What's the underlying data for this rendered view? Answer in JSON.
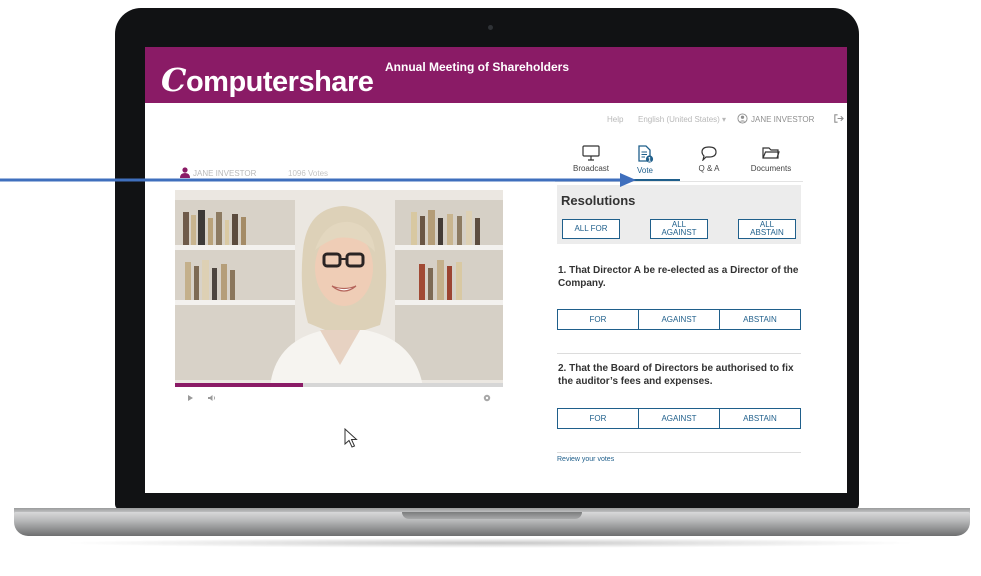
{
  "app": {
    "brand": "Computershare",
    "meeting_title": "Annual Meeting of Shareholders",
    "brand_color": "#8a1b66",
    "accent_color": "#1f5f8b"
  },
  "utility_bar": {
    "help": "Help",
    "language": "English (United States) ▾",
    "user_name": "JANE INVESTOR",
    "user_icon": "user-circle-icon",
    "logout_icon": "logout-icon"
  },
  "presenter": {
    "name": "JANE INVESTOR",
    "votes": "1096 Votes"
  },
  "video": {
    "progress": 0.39
  },
  "tabs": [
    {
      "label": "Broadcast",
      "icon": "monitor-icon"
    },
    {
      "label": "Vote",
      "icon": "document-icon",
      "badge": "1",
      "active": true
    },
    {
      "label": "Q & A",
      "icon": "speech-bubble-icon"
    },
    {
      "label": "Documents",
      "icon": "folder-icon"
    }
  ],
  "resolutions": {
    "title": "Resolutions",
    "all_for": "ALL FOR",
    "all_against_1": "ALL",
    "all_against_2": "AGAINST",
    "all_abstain_1": "ALL",
    "all_abstain_2": "ABSTAIN",
    "items": [
      {
        "text": "1. That Director A be re-elected as a Director of the Company.",
        "for": "FOR",
        "against": "AGAINST",
        "abstain": "ABSTAIN"
      },
      {
        "text": "2. That the Board of Directors be authorised to fix the auditor’s fees and expenses.",
        "for": "FOR",
        "against": "AGAINST",
        "abstain": "ABSTAIN"
      }
    ],
    "review_link": "Review your votes"
  }
}
